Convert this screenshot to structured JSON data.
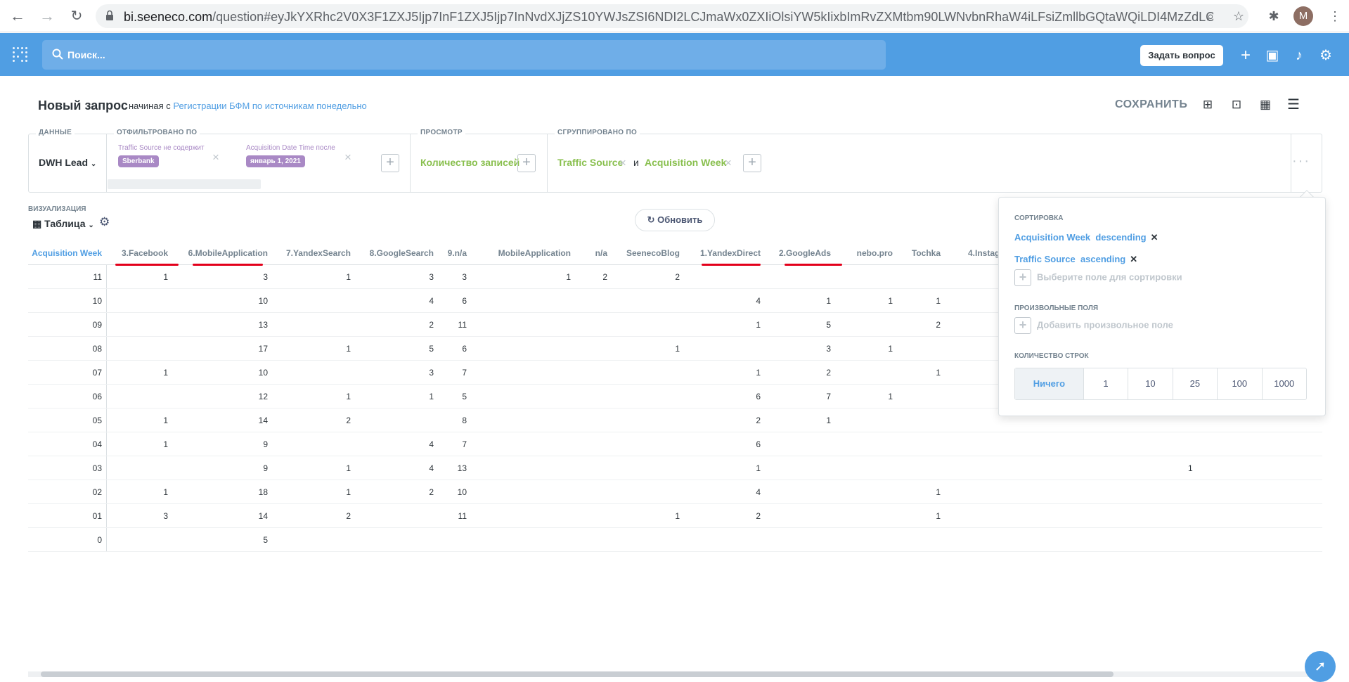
{
  "browser": {
    "url_host": "bi.seeneco.com",
    "url_path": "/question#eyJkYXRhc2V0X3F1ZXJ5Ijp7InF1ZXJ5Ijp7InNvdXJjZS10YWJsZSI6NDI2LCJmaWx0ZXIiOlsiYW5kIixbImRvZXMtbm90LWNvbnRhaW4iLFsiZmllbGQtaWQiLDI4MzZdLCJTYmVy...",
    "avatar_letter": "M"
  },
  "appbar": {
    "search_placeholder": "Поиск...",
    "ask_button": "Задать вопрос"
  },
  "header": {
    "title": "Новый запрос",
    "subtitle_prefix": "начиная с",
    "subtitle_link": "Регистрации БФМ по источникам понедельно",
    "save_label": "СОХРАНИТЬ"
  },
  "builder": {
    "data_label": "ДАННЫЕ",
    "source": "DWH Lead",
    "filter_label": "ОТФИЛЬТРОВАНО ПО",
    "filters": [
      {
        "name": "Traffic Source не содержит",
        "value": "Sberbank"
      },
      {
        "name": "Acquisition Date Time после",
        "value": "январь 1, 2021"
      }
    ],
    "view_label": "ПРОСМОТР",
    "metric": "Количество записей",
    "group_label": "СГРУППИРОВАНО ПО",
    "groups": [
      "Traffic Source",
      "Acquisition Week"
    ],
    "and_word": "и"
  },
  "viz": {
    "label": "ВИЗУАЛИЗАЦИЯ",
    "type": "Таблица",
    "refresh": "Обновить"
  },
  "table": {
    "columns": [
      "Acquisition Week",
      "3.Facebook",
      "6.MobileApplication",
      "7.YandexSearch",
      "8.GoogleSearch",
      "9.n/a",
      "MobileApplication",
      "n/a",
      "SeenecoBlog",
      "1.YandexDirect",
      "2.GoogleAds",
      "nebo.pro",
      "Tochka",
      "4.Instag"
    ],
    "rows": [
      [
        "11",
        "1",
        "3",
        "1",
        "3",
        "3",
        "1",
        "2",
        "2",
        "",
        "",
        "",
        "",
        ""
      ],
      [
        "10",
        "",
        "10",
        "",
        "4",
        "6",
        "",
        "",
        "",
        "4",
        "1",
        "1",
        "1",
        ""
      ],
      [
        "09",
        "",
        "13",
        "",
        "2",
        "11",
        "",
        "",
        "",
        "1",
        "5",
        "",
        "2",
        ""
      ],
      [
        "08",
        "",
        "17",
        "1",
        "5",
        "6",
        "",
        "",
        "1",
        "",
        "3",
        "1",
        "",
        ""
      ],
      [
        "07",
        "1",
        "10",
        "",
        "3",
        "7",
        "",
        "",
        "",
        "1",
        "2",
        "",
        "1",
        ""
      ],
      [
        "06",
        "",
        "12",
        "1",
        "1",
        "5",
        "",
        "",
        "",
        "6",
        "7",
        "1",
        "",
        ""
      ],
      [
        "05",
        "1",
        "14",
        "2",
        "",
        "8",
        "",
        "",
        "",
        "2",
        "1",
        "",
        "",
        ""
      ],
      [
        "04",
        "1",
        "9",
        "",
        "4",
        "7",
        "",
        "",
        "",
        "6",
        "",
        "",
        "",
        ""
      ],
      [
        "03",
        "",
        "9",
        "1",
        "4",
        "13",
        "",
        "",
        "",
        "1",
        "",
        "",
        "",
        ""
      ],
      [
        "02",
        "1",
        "18",
        "1",
        "2",
        "10",
        "",
        "",
        "",
        "4",
        "",
        "",
        "1",
        ""
      ],
      [
        "01",
        "3",
        "14",
        "2",
        "",
        "11",
        "",
        "",
        "1",
        "2",
        "",
        "",
        "1",
        ""
      ],
      [
        "0",
        "",
        "5",
        "",
        "",
        "",
        "",
        "",
        "",
        "",
        "",
        "",
        "",
        ""
      ]
    ],
    "extra_cell": {
      "row": "03",
      "value": "1"
    }
  },
  "popover": {
    "sort_label": "СОРТИРОВКА",
    "sorts": [
      {
        "field": "Acquisition Week",
        "direction": "descending"
      },
      {
        "field": "Traffic Source",
        "direction": "ascending"
      }
    ],
    "sort_add": "Выберите поле для сортировки",
    "custom_label": "ПРОИЗВОЛЬНЫЕ ПОЛЯ",
    "custom_add": "Добавить произвольное поле",
    "rows_label": "КОЛИЧЕСТВО СТРОК",
    "row_options": [
      "Ничего",
      "1",
      "10",
      "25",
      "100",
      "1000"
    ]
  },
  "colors": {
    "brand": "#509ee3",
    "filter": "#a989c5",
    "summarize": "#88bf4d",
    "annotation": "#e3001b"
  }
}
